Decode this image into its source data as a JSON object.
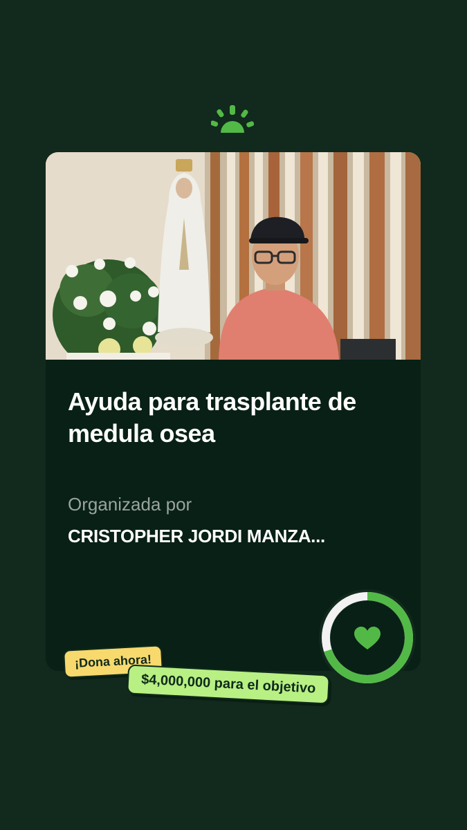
{
  "brand": {
    "logo": "gofundme-sunburst-logo",
    "accent": "#52b947"
  },
  "campaign": {
    "image": "photo of a man in a pink shirt and cap beside a statue of the Virgin Mary with white flowers",
    "title": "Ayuda para trasplante de medula osea",
    "organized_by_label": "Organizada por",
    "organizer": "CRISTOPHER JORDI MANZA...",
    "progress_fraction": 0.7,
    "progress_icon": "heart-icon"
  },
  "cta": {
    "donate_label": "¡Dona ahora!",
    "goal_text": "$4,000,000 para el objetivo"
  },
  "colors": {
    "background": "#12291d",
    "card": "#082015",
    "donate_tag": "#f8d96d",
    "goal_tag": "#b8f084",
    "ring_track": "#f2f2f2",
    "ring_fill": "#52b947"
  }
}
